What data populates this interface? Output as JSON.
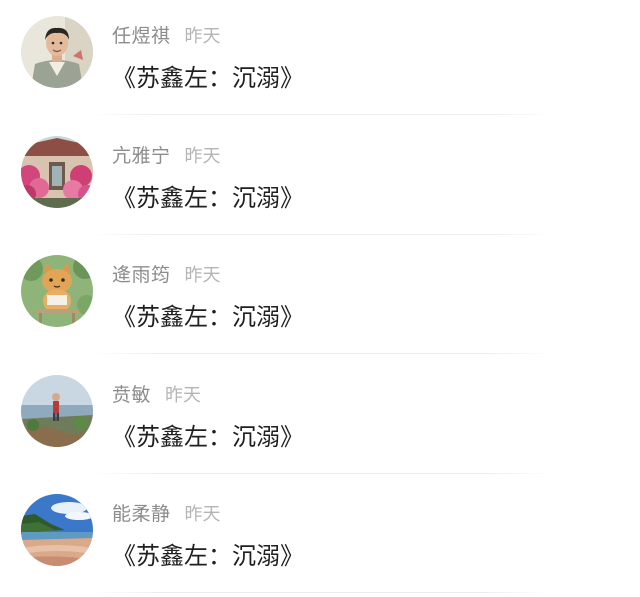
{
  "comments": [
    {
      "name": "任煜祺",
      "time": "昨天",
      "message": "《苏鑫左：沉溺》",
      "avatar_icon": "young-man-avatar-icon"
    },
    {
      "name": "亢雅宁",
      "time": "昨天",
      "message": "《苏鑫左：沉溺》",
      "avatar_icon": "flower-house-avatar-icon"
    },
    {
      "name": "逄雨筠",
      "time": "昨天",
      "message": "《苏鑫左：沉溺》",
      "avatar_icon": "cartoon-cat-avatar-icon"
    },
    {
      "name": "贲敏",
      "time": "昨天",
      "message": "《苏鑫左：沉溺》",
      "avatar_icon": "lakeside-person-avatar-icon"
    },
    {
      "name": "能柔静",
      "time": "昨天",
      "message": "《苏鑫左：沉溺》",
      "avatar_icon": "beach-landscape-avatar-icon"
    }
  ]
}
